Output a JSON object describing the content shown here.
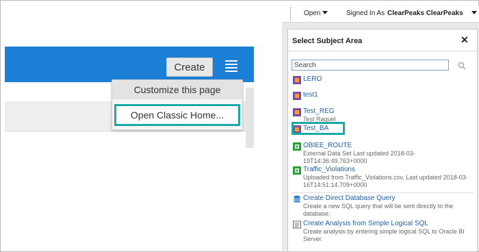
{
  "left": {
    "create_label": "Create",
    "menu_items": [
      "Customize this page",
      "Open Classic Home..."
    ]
  },
  "right": {
    "topbar": {
      "open_label": "Open",
      "signed_in_label": "Signed In As",
      "user_name": "ClearPeaks ClearPeaks"
    },
    "dialog": {
      "title": "Select Subject Area",
      "search_value": "Search",
      "items": [
        {
          "name": "LERO",
          "desc": "",
          "icon": "subject-area-icon"
        },
        {
          "name": "test1",
          "desc": "",
          "icon": "subject-area-icon"
        },
        {
          "name": "Test_REG",
          "desc": "Test Raquel",
          "icon": "subject-area-icon"
        },
        {
          "name": "Test_BA",
          "desc": "",
          "icon": "subject-area-icon"
        },
        {
          "name": "OBIEE_ROUTE",
          "desc": "External Data Set Last updated 2018-03-19T14:36:49.763+0000",
          "icon": "dataset-icon"
        },
        {
          "name": "Traffic_Violations",
          "desc": "Uploaded from Traffic_Violations.csv. Last updated 2018-03-16T14:51:14.709+0000",
          "icon": "dataset-icon"
        },
        {
          "name": "Create Direct Database Query",
          "desc": "Create a new SQL query that will be sent directly to the database.",
          "icon": "database-icon"
        },
        {
          "name": "Create Analysis from Simple Logical SQL",
          "desc": "Create analysis by entering simple logical SQL to Oracle BI Server.",
          "icon": "sql-icon"
        }
      ]
    }
  },
  "colors": {
    "brand_blue": "#1c7fd6",
    "highlight_teal": "#1aa9a4",
    "link_blue": "#1f5fa6"
  }
}
